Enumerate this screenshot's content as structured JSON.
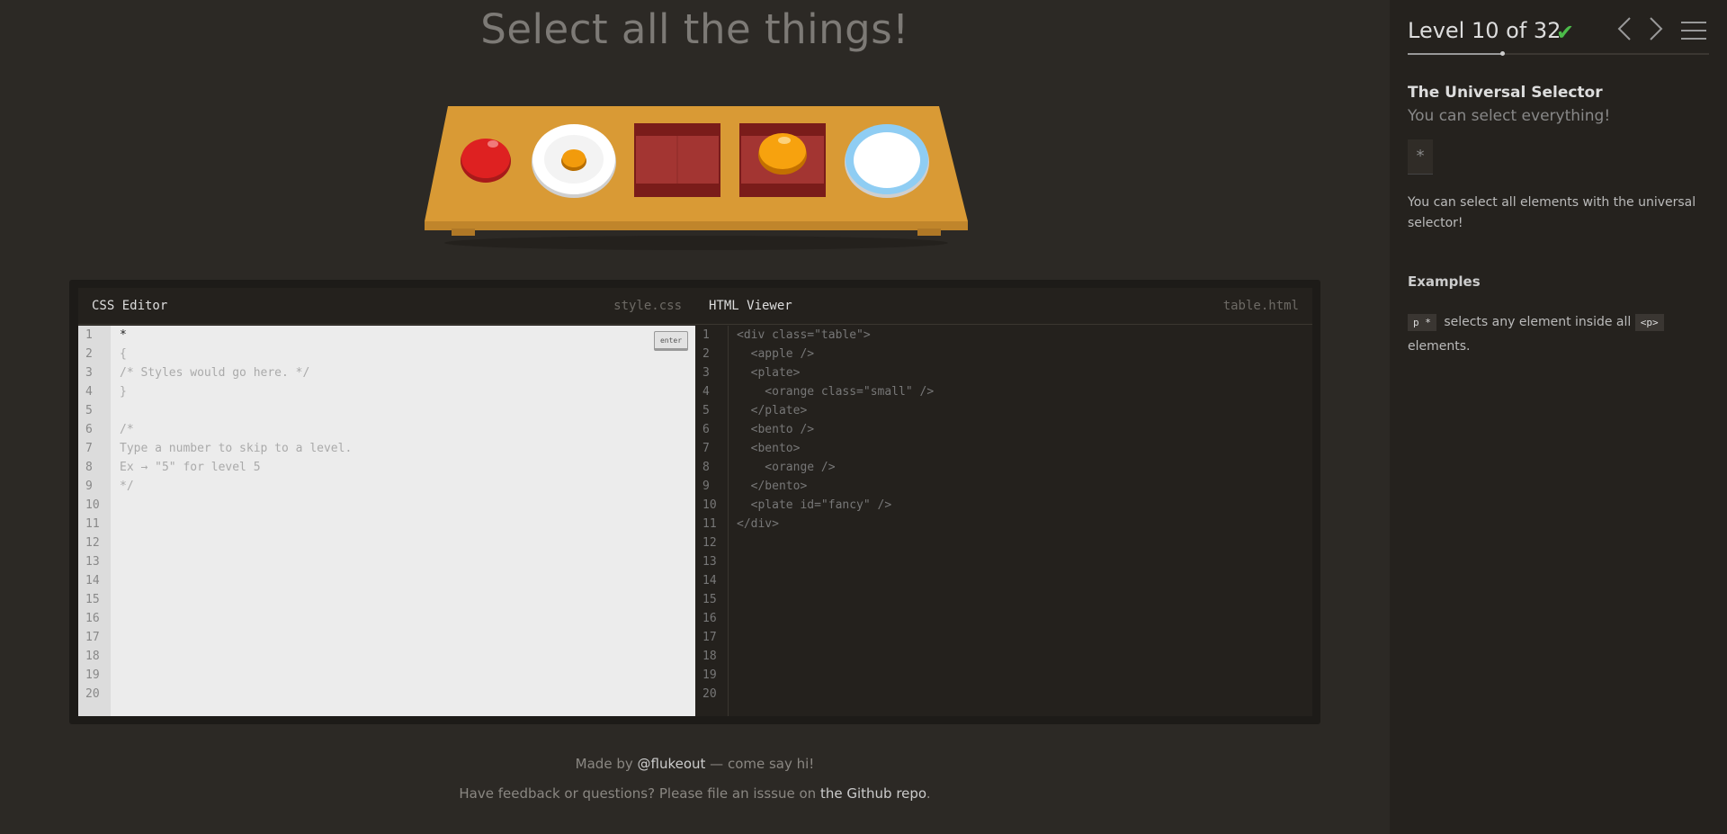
{
  "main": {
    "title": "Select all the things!"
  },
  "editor": {
    "css_label": "CSS Editor",
    "css_file": "style.css",
    "enter_label": "enter",
    "css_lines": [
      "*",
      "{",
      "/* Styles would go here. */",
      "}",
      "",
      "/*",
      "Type a number to skip to a level.",
      "Ex → \"5\" for level 5",
      "*/",
      "",
      "",
      "",
      "",
      "",
      "",
      "",
      "",
      "",
      "",
      ""
    ],
    "html_label": "HTML Viewer",
    "html_file": "table.html",
    "html_lines": [
      "<div class=\"table\">",
      "  <apple />",
      "  <plate>",
      "    <orange class=\"small\" />",
      "  </plate>",
      "  <bento />",
      "  <bento>",
      "    <orange />",
      "  </bento>",
      "  <plate id=\"fancy\" />",
      "</div>",
      "",
      "",
      "",
      "",
      "",
      "",
      "",
      "",
      ""
    ],
    "line_numbers": [
      "1",
      "2",
      "3",
      "4",
      "5",
      "6",
      "7",
      "8",
      "9",
      "10",
      "11",
      "12",
      "13",
      "14",
      "15",
      "16",
      "17",
      "18",
      "19",
      "20"
    ]
  },
  "footer": {
    "made_by_prefix": "Made by ",
    "made_by_link": "@flukeout",
    "made_by_suffix": " — come say hi!",
    "feedback_prefix": "Have feedback or questions? Please file an isssue on ",
    "feedback_link": "the Github repo",
    "feedback_suffix": "."
  },
  "sidebar": {
    "level_text": "Level 10 of 32",
    "progress_fraction": 0.3125,
    "check_icon": "check-icon",
    "title": "The Universal Selector",
    "subtitle": "You can select everything!",
    "syntax": "*",
    "description": "You can select all elements with the universal selector!",
    "examples_title": "Examples",
    "example_code1": "p *",
    "example_text1": " selects any element inside all ",
    "example_code2": "<p>",
    "example_text2": " elements.",
    "colors": {
      "check": "#4cbb4a"
    }
  }
}
